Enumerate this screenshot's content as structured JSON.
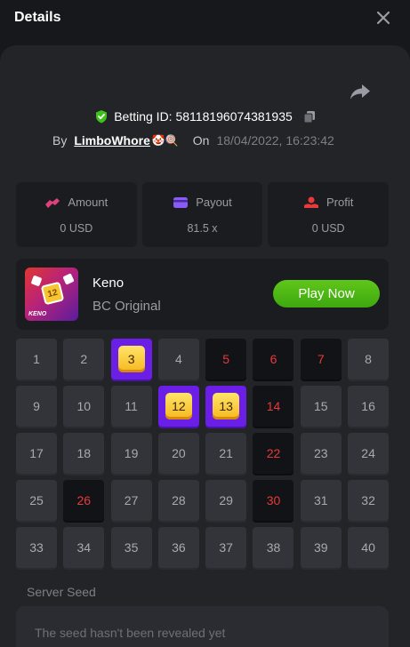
{
  "header": {
    "title": "Details"
  },
  "bet": {
    "id_text": "Betting ID: 58118196074381935",
    "by_label": "By",
    "username": "LimboWhore",
    "username_emoji": "🤡🍭",
    "on_label": "On",
    "datetime": "18/04/2022, 16:23:42"
  },
  "stats": [
    {
      "label": "Amount",
      "value": "0 USD",
      "icon": "bet-icon",
      "color": "#e0407e"
    },
    {
      "label": "Payout",
      "value": "81.5 x",
      "icon": "wallet-icon",
      "color": "#8a5cf5"
    },
    {
      "label": "Profit",
      "value": "0 USD",
      "icon": "profit-icon",
      "color": "#e8393b"
    }
  ],
  "game": {
    "name": "Keno",
    "subtitle": "BC Original",
    "play_label": "Play Now",
    "thumb_number": "12",
    "thumb_label": "KENO"
  },
  "grid": {
    "hits": [
      3,
      12,
      13
    ],
    "misses": [
      5,
      6,
      7,
      14,
      22,
      26,
      30
    ]
  },
  "seed": {
    "label": "Server Seed",
    "text": "The seed hasn't been revealed yet"
  },
  "colors": {
    "accent_green": "#3ea80f",
    "hit_purple": "#6b1fe6",
    "miss_red": "#e8393b",
    "gem_gold": "#f5b81d"
  }
}
